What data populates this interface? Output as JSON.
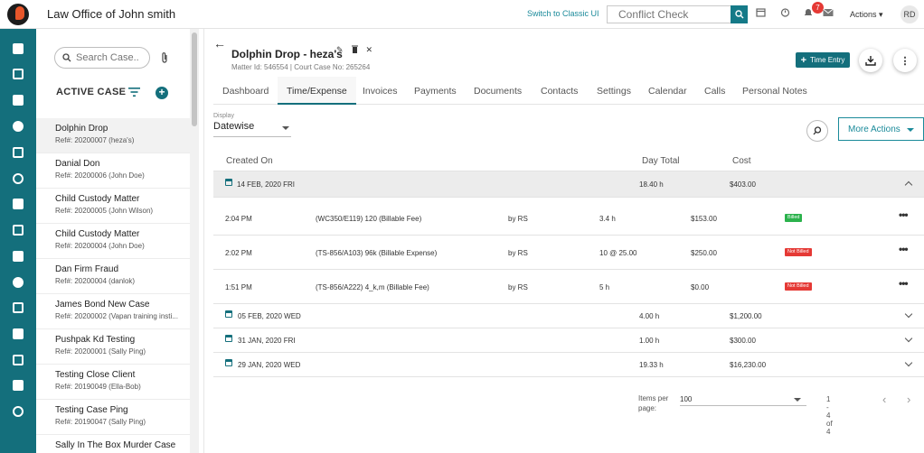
{
  "topbar": {
    "office_title": "Law Office of John smith",
    "classic_link": "Switch to Classic UI",
    "conflict_placeholder": "Conflict Check",
    "notification_count": "7",
    "actions_label": "Actions",
    "avatar_initials": "RD"
  },
  "rail": {
    "icons": [
      "add-matter-icon",
      "dashboard-icon",
      "building-icon",
      "graduation-cap-icon",
      "bank-icon",
      "contacts-icon",
      "billing-icon",
      "calendar-icon",
      "clipboard-icon",
      "user-icon",
      "reports-icon",
      "apps-grid-icon",
      "settings-icon",
      "card-icon",
      "phone-icon"
    ]
  },
  "cases": {
    "search_placeholder": "Search Case..",
    "section_title": "ACTIVE CASE",
    "items": [
      {
        "name": "Dolphin Drop",
        "ref": "Ref#: 20200007 (heza's)"
      },
      {
        "name": "Danial Don",
        "ref": "Ref#: 20200006 (John Doe)"
      },
      {
        "name": "Child Custody Matter",
        "ref": "Ref#: 20200005 (John Wilson)"
      },
      {
        "name": "Child Custody Matter",
        "ref": "Ref#: 20200004 (John Doe)"
      },
      {
        "name": "Dan Firm Fraud",
        "ref": "Ref#: 20200004 (danlok)"
      },
      {
        "name": "James Bond New Case",
        "ref": "Ref#: 20200002 (Vapan training insti..."
      },
      {
        "name": "Pushpak Kd Testing",
        "ref": "Ref#: 20200001 (Sally Ping)"
      },
      {
        "name": "Testing Close Client",
        "ref": "Ref#: 20190049 (Ella-Bob)"
      },
      {
        "name": "Testing Case Ping",
        "ref": "Ref#: 20190047 (Sally Ping)"
      },
      {
        "name": "Sally In The Box Murder Case",
        "ref": ""
      }
    ]
  },
  "matter": {
    "title": "Dolphin Drop - heza's",
    "subtitle": "Matter Id: 546554 | Court Case No: 265264",
    "time_entry_label": "Time Entry"
  },
  "tabs": [
    "Dashboard",
    "Time/Expense",
    "Invoices",
    "Payments",
    "Documents",
    "Contacts",
    "Settings",
    "Calendar",
    "Calls",
    "Personal Notes"
  ],
  "display": {
    "label": "Display",
    "value": "Datewise"
  },
  "more_actions_label": "More Actions",
  "grid": {
    "headers": {
      "created_on": "Created On",
      "day_total": "Day Total",
      "cost": "Cost"
    },
    "groups": [
      {
        "date": "14 FEB, 2020 FRI",
        "total": "18.40 h",
        "cost": "$403.00",
        "entries": [
          {
            "time": "2:04 PM",
            "desc": "(WC350/E119) 120 (Billable Fee)",
            "by": "by RS",
            "qty": "3.4 h",
            "amount": "$153.00",
            "status": "Billed",
            "status_color": "#2bb24c"
          },
          {
            "time": "2:02 PM",
            "desc": "(TS-856/A103) 96k (Billable Expense)",
            "by": "by RS",
            "qty": "10 @ 25.00",
            "amount": "$250.00",
            "status": "Not Billed",
            "status_color": "#e53935"
          },
          {
            "time": "1:51 PM",
            "desc": "(TS-856/A222) 4_k,m (Billable Fee)",
            "by": "by RS",
            "qty": "5 h",
            "amount": "$0.00",
            "status": "Not Billed",
            "status_color": "#e53935"
          }
        ]
      },
      {
        "date": "05 FEB, 2020 WED",
        "total": "4.00 h",
        "cost": "$1,200.00",
        "entries": []
      },
      {
        "date": "31 JAN, 2020 FRI",
        "total": "1.00 h",
        "cost": "$300.00",
        "entries": []
      },
      {
        "date": "29 JAN, 2020 WED",
        "total": "19.33 h",
        "cost": "$16,230.00",
        "entries": []
      }
    ]
  },
  "pager": {
    "items_per_page_label": "Items per page:",
    "items_per_page": "100",
    "range": "1 - 4 of 4"
  }
}
